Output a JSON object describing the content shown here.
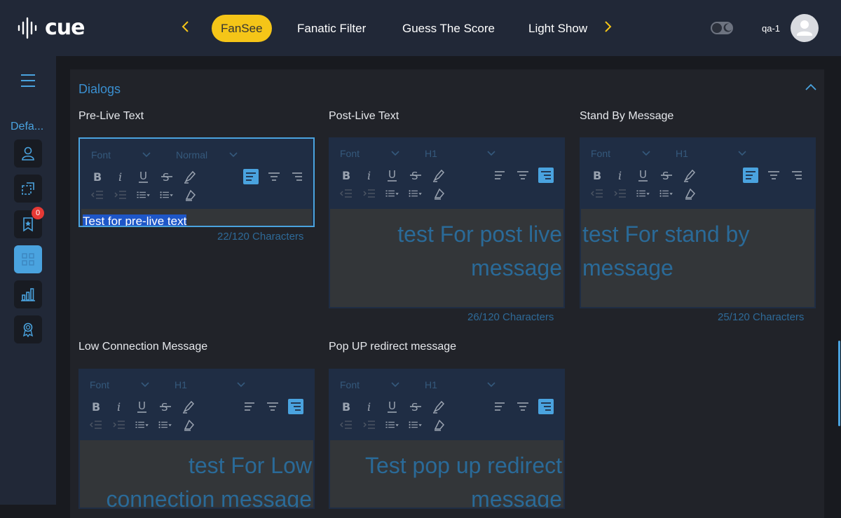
{
  "app": {
    "logo_text": "cue",
    "user": "qa-1",
    "theme": "dark"
  },
  "nav": {
    "tabs": [
      {
        "label": "FanSee",
        "active": true
      },
      {
        "label": "Fanatic Filter",
        "active": false
      },
      {
        "label": "Guess The Score",
        "active": false
      },
      {
        "label": "Light Show",
        "active": false
      }
    ]
  },
  "sidebar": {
    "label": "Defa...",
    "items": [
      {
        "icon": "user-icon"
      },
      {
        "icon": "crop-icon"
      },
      {
        "icon": "bookmark-star-icon",
        "badge": "0"
      },
      {
        "icon": "grid-icon",
        "active": true
      },
      {
        "icon": "bar-chart-icon"
      },
      {
        "icon": "award-icon"
      }
    ]
  },
  "section": {
    "title": "Dialogs"
  },
  "toolbar_common": {
    "font_placeholder": "Font"
  },
  "fields": [
    {
      "label": "Pre-Live Text",
      "size": "Normal",
      "align": "left",
      "content": "Test for pre-live text",
      "count": "22/120 Characters"
    },
    {
      "label": "Post-Live Text",
      "size": "H1",
      "align": "right",
      "content": "test For post live message",
      "count": "26/120 Characters"
    },
    {
      "label": "Stand By Message",
      "size": "H1",
      "align": "left",
      "content": "test For stand by message",
      "count": "25/120 Characters"
    },
    {
      "label": "Low Connection Message",
      "size": "H1",
      "align": "right",
      "content": "test For Low connection message",
      "count": ""
    },
    {
      "label": "Pop UP redirect message",
      "size": "H1",
      "align": "right",
      "content": "Test pop up redirect message",
      "count": ""
    }
  ],
  "colors": {
    "accent": "#4aa3df",
    "brand": "#f5c518",
    "header_bg": "#212837",
    "editor_bg": "#1f2d44",
    "content_bg": "#333639"
  }
}
